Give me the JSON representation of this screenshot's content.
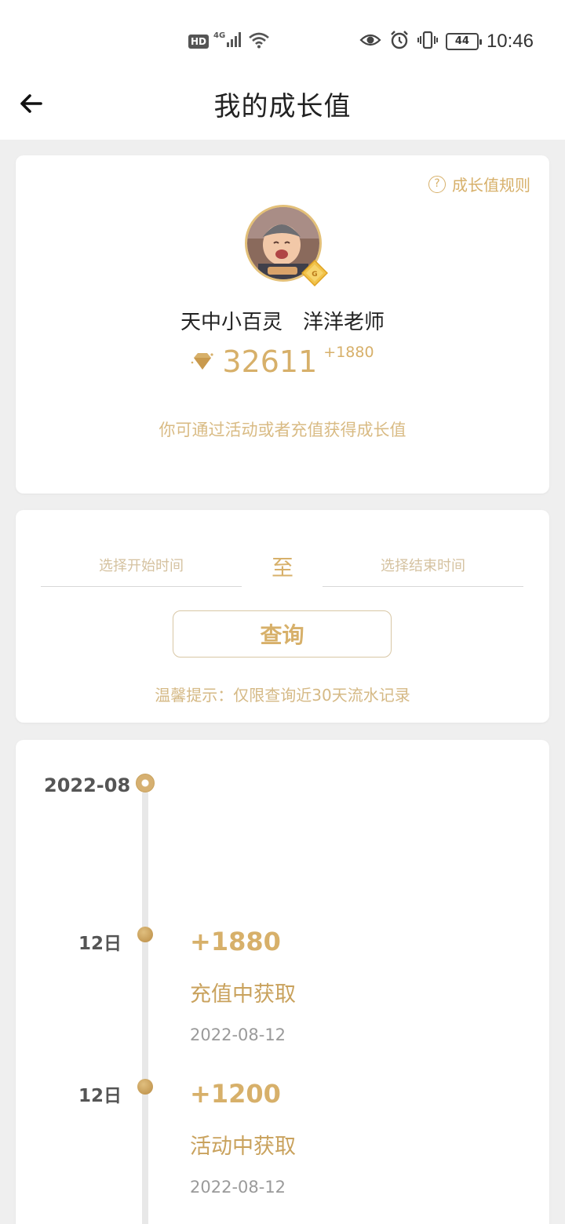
{
  "status_bar": {
    "hd": "HD",
    "network": "4G",
    "battery": "44",
    "time": "10:46"
  },
  "header": {
    "title": "我的成长值"
  },
  "profile": {
    "rules_link": "成长值规则",
    "name": "天中小百灵　洋洋老师",
    "points": "32611",
    "points_delta": "+1880",
    "hint": "你可通过活动或者充值获得成长值",
    "accent_color": "#d7b06a"
  },
  "query": {
    "start_placeholder": "选择开始时间",
    "to_label": "至",
    "end_placeholder": "选择结束时间",
    "button_label": "查询",
    "tip": "温馨提示：仅限查询近30天流水记录"
  },
  "timeline": {
    "month": "2022-08",
    "entries": [
      {
        "day": "12日",
        "amount": "+1880",
        "source": "充值中获取",
        "date": "2022-08-12"
      },
      {
        "day": "12日",
        "amount": "+1200",
        "source": "活动中获取",
        "date": "2022-08-12"
      }
    ]
  }
}
